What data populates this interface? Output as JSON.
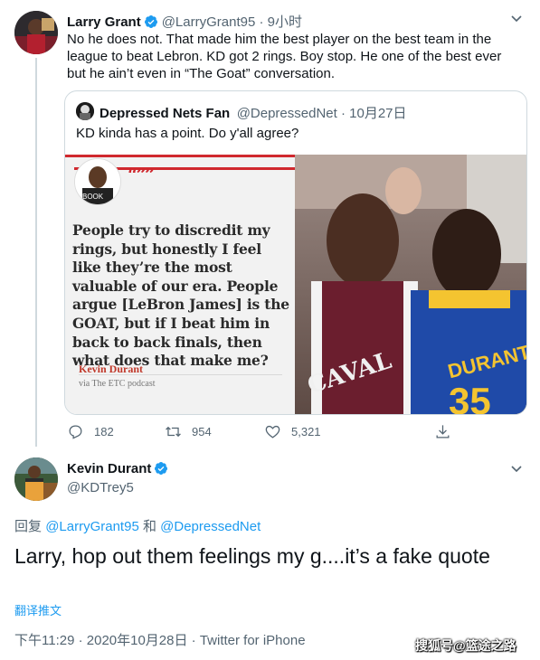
{
  "tweet1": {
    "name": "Larry Grant",
    "handle": "@LarryGrant95",
    "time": "9小时",
    "text": "No he does not.  That made him the best player on the best team in the league to beat Lebron.  KD got 2 rings.  Boy stop.  He one of the best ever but he ain’t even in  “The Goat”  conversation.",
    "more_icon": "chevron-down-icon",
    "actions": {
      "replies": "182",
      "retweets": "954",
      "likes": "5,321"
    }
  },
  "quoted": {
    "name": "Depressed Nets Fan",
    "handle": "@DepressedNet",
    "date": "10月27日",
    "text": "KD kinda has a point. Do y'all agree?",
    "media": {
      "quote_mark": "“””",
      "quote_text": "People try to discredit my rings, but honestly I feel like they’re the most valuable of our era. People argue [LeBron James] is the GOAT, but if I beat him in back to back finals, then what does that make me?",
      "quote_author": "Kevin Durant",
      "quote_source": "via The ETC podcast",
      "jersey_left": "CAVAL",
      "jersey_right": "DURANT",
      "jersey_number": "35"
    }
  },
  "tweet2": {
    "name": "Kevin Durant",
    "handle": "@KDTrey5",
    "reply_prefix": "回复",
    "reply_to_1": "@LarryGrant95",
    "reply_and": "和",
    "reply_to_2": "@DepressedNet",
    "text": "Larry, hop out them feelings my g....it’s a fake quote",
    "translate": "翻译推文",
    "meta": "下午11:29 · 2020年10月28日 · Twitter for iPhone"
  },
  "watermark": "搜狐号@篮途之路",
  "colors": {
    "verified": "#1d9bf0",
    "link": "#1d9bf0",
    "muted": "#536471",
    "quote_red": "#d0282e"
  }
}
